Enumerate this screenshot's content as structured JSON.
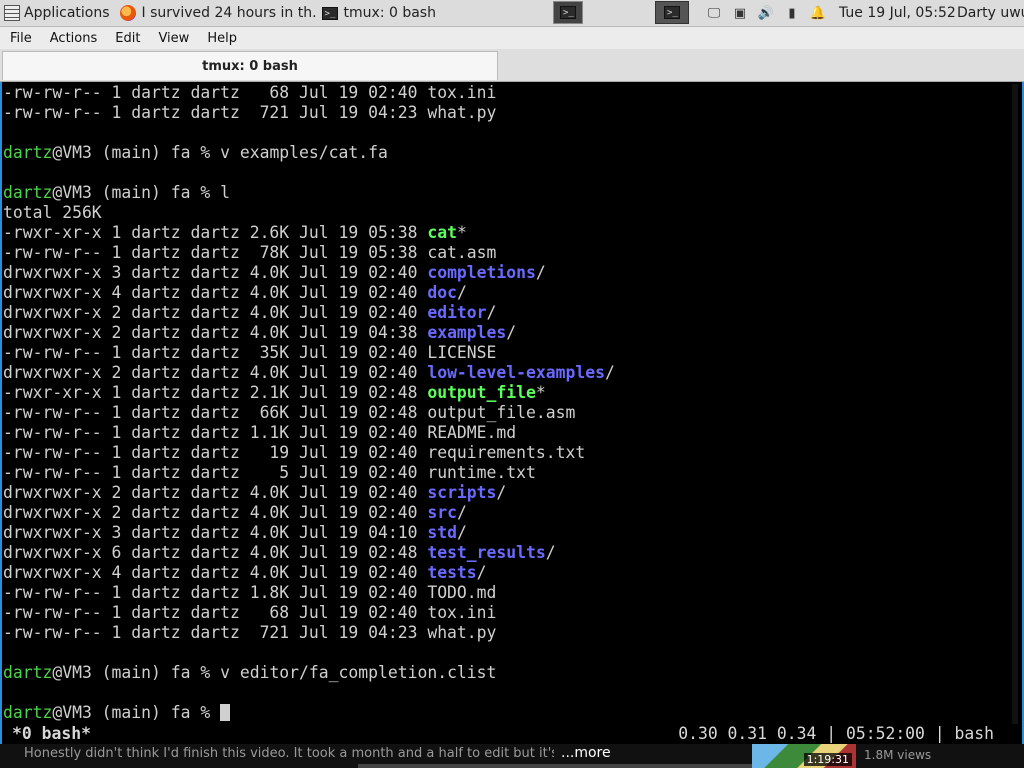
{
  "panel": {
    "applications": "Applications",
    "task1": "I survived 24 hours in th...",
    "task2": "tmux: 0 bash",
    "clock": "Tue 19 Jul, 05:52",
    "user": "Darty uwu"
  },
  "menu": [
    "File",
    "Actions",
    "Edit",
    "View",
    "Help"
  ],
  "tab": {
    "title": "tmux: 0 bash"
  },
  "terminal": {
    "lines": [
      [
        {
          "t": "-rw-rw-r-- 1 dartz dartz   68 Jul 19 02:40 tox.ini"
        }
      ],
      [
        {
          "t": "-rw-rw-r-- 1 dartz dartz  721 Jul 19 04:23 what.py"
        }
      ],
      [
        {
          "t": ""
        }
      ],
      [
        {
          "t": "dartz",
          "c": "user-c"
        },
        {
          "t": "@VM3 (main) fa % v examples/cat.fa"
        }
      ],
      [
        {
          "t": ""
        }
      ],
      [
        {
          "t": "dartz",
          "c": "user-c"
        },
        {
          "t": "@VM3 (main) fa % l"
        }
      ],
      [
        {
          "t": "total 256K"
        }
      ],
      [
        {
          "t": "-rwxr-xr-x 1 dartz dartz 2.6K Jul 19 05:38 "
        },
        {
          "t": "cat",
          "c": "exe"
        },
        {
          "t": "*"
        }
      ],
      [
        {
          "t": "-rw-rw-r-- 1 dartz dartz  78K Jul 19 05:38 cat.asm"
        }
      ],
      [
        {
          "t": "drwxrwxr-x 3 dartz dartz 4.0K Jul 19 02:40 "
        },
        {
          "t": "completions",
          "c": "dir"
        },
        {
          "t": "/"
        }
      ],
      [
        {
          "t": "drwxrwxr-x 4 dartz dartz 4.0K Jul 19 02:40 "
        },
        {
          "t": "doc",
          "c": "dir"
        },
        {
          "t": "/"
        }
      ],
      [
        {
          "t": "drwxrwxr-x 2 dartz dartz 4.0K Jul 19 02:40 "
        },
        {
          "t": "editor",
          "c": "dir"
        },
        {
          "t": "/"
        }
      ],
      [
        {
          "t": "drwxrwxr-x 2 dartz dartz 4.0K Jul 19 04:38 "
        },
        {
          "t": "examples",
          "c": "dir"
        },
        {
          "t": "/"
        }
      ],
      [
        {
          "t": "-rw-rw-r-- 1 dartz dartz  35K Jul 19 02:40 LICENSE"
        }
      ],
      [
        {
          "t": "drwxrwxr-x 2 dartz dartz 4.0K Jul 19 02:40 "
        },
        {
          "t": "low-level-examples",
          "c": "dir"
        },
        {
          "t": "/"
        }
      ],
      [
        {
          "t": "-rwxr-xr-x 1 dartz dartz 2.1K Jul 19 02:48 "
        },
        {
          "t": "output_file",
          "c": "exe"
        },
        {
          "t": "*"
        }
      ],
      [
        {
          "t": "-rw-rw-r-- 1 dartz dartz  66K Jul 19 02:48 output_file.asm"
        }
      ],
      [
        {
          "t": "-rw-rw-r-- 1 dartz dartz 1.1K Jul 19 02:40 README.md"
        }
      ],
      [
        {
          "t": "-rw-rw-r-- 1 dartz dartz   19 Jul 19 02:40 requirements.txt"
        }
      ],
      [
        {
          "t": "-rw-rw-r-- 1 dartz dartz    5 Jul 19 02:40 runtime.txt"
        }
      ],
      [
        {
          "t": "drwxrwxr-x 2 dartz dartz 4.0K Jul 19 02:40 "
        },
        {
          "t": "scripts",
          "c": "dir"
        },
        {
          "t": "/"
        }
      ],
      [
        {
          "t": "drwxrwxr-x 2 dartz dartz 4.0K Jul 19 02:40 "
        },
        {
          "t": "src",
          "c": "dir"
        },
        {
          "t": "/"
        }
      ],
      [
        {
          "t": "drwxrwxr-x 3 dartz dartz 4.0K Jul 19 04:10 "
        },
        {
          "t": "std",
          "c": "dir"
        },
        {
          "t": "/"
        }
      ],
      [
        {
          "t": "drwxrwxr-x 6 dartz dartz 4.0K Jul 19 02:48 "
        },
        {
          "t": "test_results",
          "c": "dir"
        },
        {
          "t": "/"
        }
      ],
      [
        {
          "t": "drwxrwxr-x 4 dartz dartz 4.0K Jul 19 02:40 "
        },
        {
          "t": "tests",
          "c": "dir"
        },
        {
          "t": "/"
        }
      ],
      [
        {
          "t": "-rw-rw-r-- 1 dartz dartz 1.8K Jul 19 02:40 TODO.md"
        }
      ],
      [
        {
          "t": "-rw-rw-r-- 1 dartz dartz   68 Jul 19 02:40 tox.ini"
        }
      ],
      [
        {
          "t": "-rw-rw-r-- 1 dartz dartz  721 Jul 19 04:23 what.py"
        }
      ],
      [
        {
          "t": ""
        }
      ],
      [
        {
          "t": "dartz",
          "c": "user-c"
        },
        {
          "t": "@VM3 (main) fa % v editor/fa_completion.clist"
        }
      ],
      [
        {
          "t": ""
        }
      ],
      [
        {
          "t": "dartz",
          "c": "user-c"
        },
        {
          "t": "@VM3 (main) fa % "
        },
        {
          "cursor": true
        }
      ]
    ],
    "status_left": "*0 bash*",
    "status_right": "0.30 0.31 0.34 | 05:52:00 | bash"
  },
  "video": {
    "description": "Honestly didn't think I'd finish this video. It took a month and a half to edit but it's done",
    "more": "...more",
    "duration": "1:19:31",
    "views": "1.8M views"
  },
  "colors": {
    "user": "#4cd44c",
    "directory": "#6a6aff",
    "executable": "#5cff5c",
    "focus_border": "#2a8fdb"
  }
}
